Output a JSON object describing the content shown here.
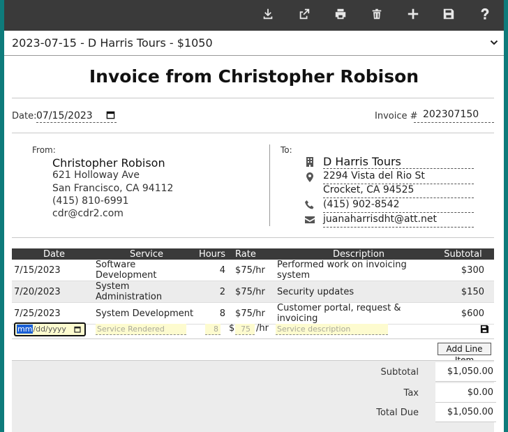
{
  "toolbar": {
    "icons": [
      "download-icon",
      "share-icon",
      "print-icon",
      "trash-icon",
      "plus-icon",
      "save-icon",
      "help-icon"
    ]
  },
  "invoice_select": {
    "selected": "2023-07-15 - D Harris Tours - $1050"
  },
  "header": {
    "title": "Invoice from Christopher Robison"
  },
  "meta": {
    "date_label": "Date:",
    "date_value": "07/15/2023",
    "invoice_label": "Invoice #",
    "invoice_number": "202307150"
  },
  "from": {
    "label": "From:",
    "name": "Christopher Robison",
    "address1": "621 Holloway Ave",
    "address2": "San Francisco, CA 94112",
    "phone": "(415) 810-6991",
    "email": "cdr@cdr2.com"
  },
  "to": {
    "label": "To:",
    "name": "D Harris Tours",
    "address1": "2294 Vista del Rio St",
    "address2": "Crocket, CA 94525",
    "phone": "(415) 902-8542",
    "email": "juanaharrisdht@att.net"
  },
  "table": {
    "headers": [
      "Date",
      "Service",
      "Hours",
      "Rate",
      "Description",
      "Subtotal"
    ],
    "rows": [
      {
        "date": "7/15/2023",
        "service": "Software Development",
        "hours": "4",
        "rate": "$75/hr",
        "description": "Performed work on invoicing system",
        "subtotal": "$300"
      },
      {
        "date": "7/20/2023",
        "service": "System Administration",
        "hours": "2",
        "rate": "$75/hr",
        "description": "Security updates",
        "subtotal": "$150"
      },
      {
        "date": "7/25/2023",
        "service": "System Development",
        "hours": "8",
        "rate": "$75/hr",
        "description": "Customer portal, request & invoicing",
        "subtotal": "$600"
      }
    ]
  },
  "new_row": {
    "date_mm": "mm",
    "date_rest": "/dd/yyyy",
    "service_placeholder": "Service Rendered",
    "hours_placeholder": "8",
    "rate_prefix": "$",
    "rate_placeholder": "75",
    "rate_suffix": "/hr",
    "description_placeholder": "Service description"
  },
  "add_button": "Add Line Item",
  "totals": {
    "subtotal_label": "Subtotal",
    "subtotal": "$1,050.00",
    "tax_label": "Tax",
    "tax": "$0.00",
    "total_label": "Total Due",
    "total": "$1,050.00"
  },
  "colors": {
    "background": "#0e7b7b",
    "toolbar": "#3a3a3a",
    "input_highlight": "#fdfbcf",
    "focus": "#1a5fd6"
  }
}
